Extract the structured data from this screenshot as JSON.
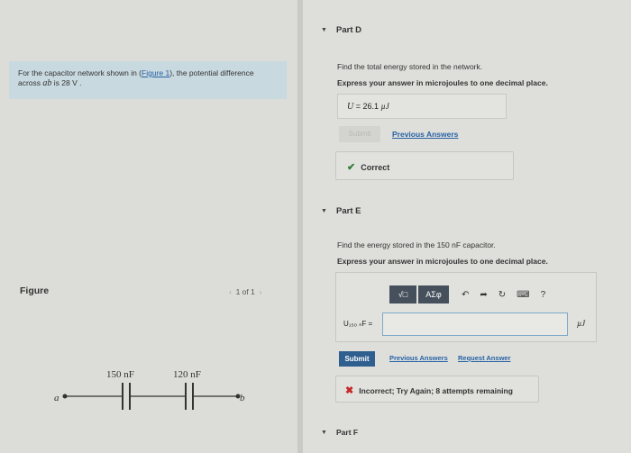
{
  "problem": {
    "text_before": "For the capacitor network shown in (",
    "figure_link": "Figure 1",
    "text_middle": "), the potential difference across ",
    "ab": "ab",
    "text_after": " is 28 V ."
  },
  "figure": {
    "label": "Figure",
    "pager": "1 of 1",
    "prev_arrow": "‹",
    "next_arrow": "›",
    "cap1": "150 nF",
    "cap2": "120 nF",
    "node_a": "a",
    "node_b": "b"
  },
  "partD": {
    "title": "Part D",
    "question": "Find the total energy stored in the network.",
    "instruction": "Express your answer in microjoules to one decimal place.",
    "answer_var": "U",
    "answer_value": " = 26.1 ",
    "answer_unit": "µJ",
    "submit_label": "Submit",
    "previous_answers": "Previous Answers",
    "feedback": "Correct"
  },
  "partE": {
    "title": "Part E",
    "question": "Find the energy stored in the 150 nF capacitor.",
    "instruction": "Express your answer in microjoules to one decimal place.",
    "toolbar_sqrt": "√□",
    "toolbar_greek": "ΑΣφ",
    "input_label": "U₁₅₀ ₙF =",
    "input_value": "",
    "unit": "µJ",
    "submit_label": "Submit",
    "previous_answers": "Previous Answers",
    "request_answer": "Request Answer",
    "feedback": "Incorrect; Try Again; 8 attempts remaining"
  },
  "partF": {
    "title": "Part F"
  },
  "colors": {
    "accent": "#2f5f8f",
    "link": "#2763a5",
    "correct": "#2e7d32",
    "incorrect": "#c62828",
    "problem_bg": "#c9d9e0"
  }
}
